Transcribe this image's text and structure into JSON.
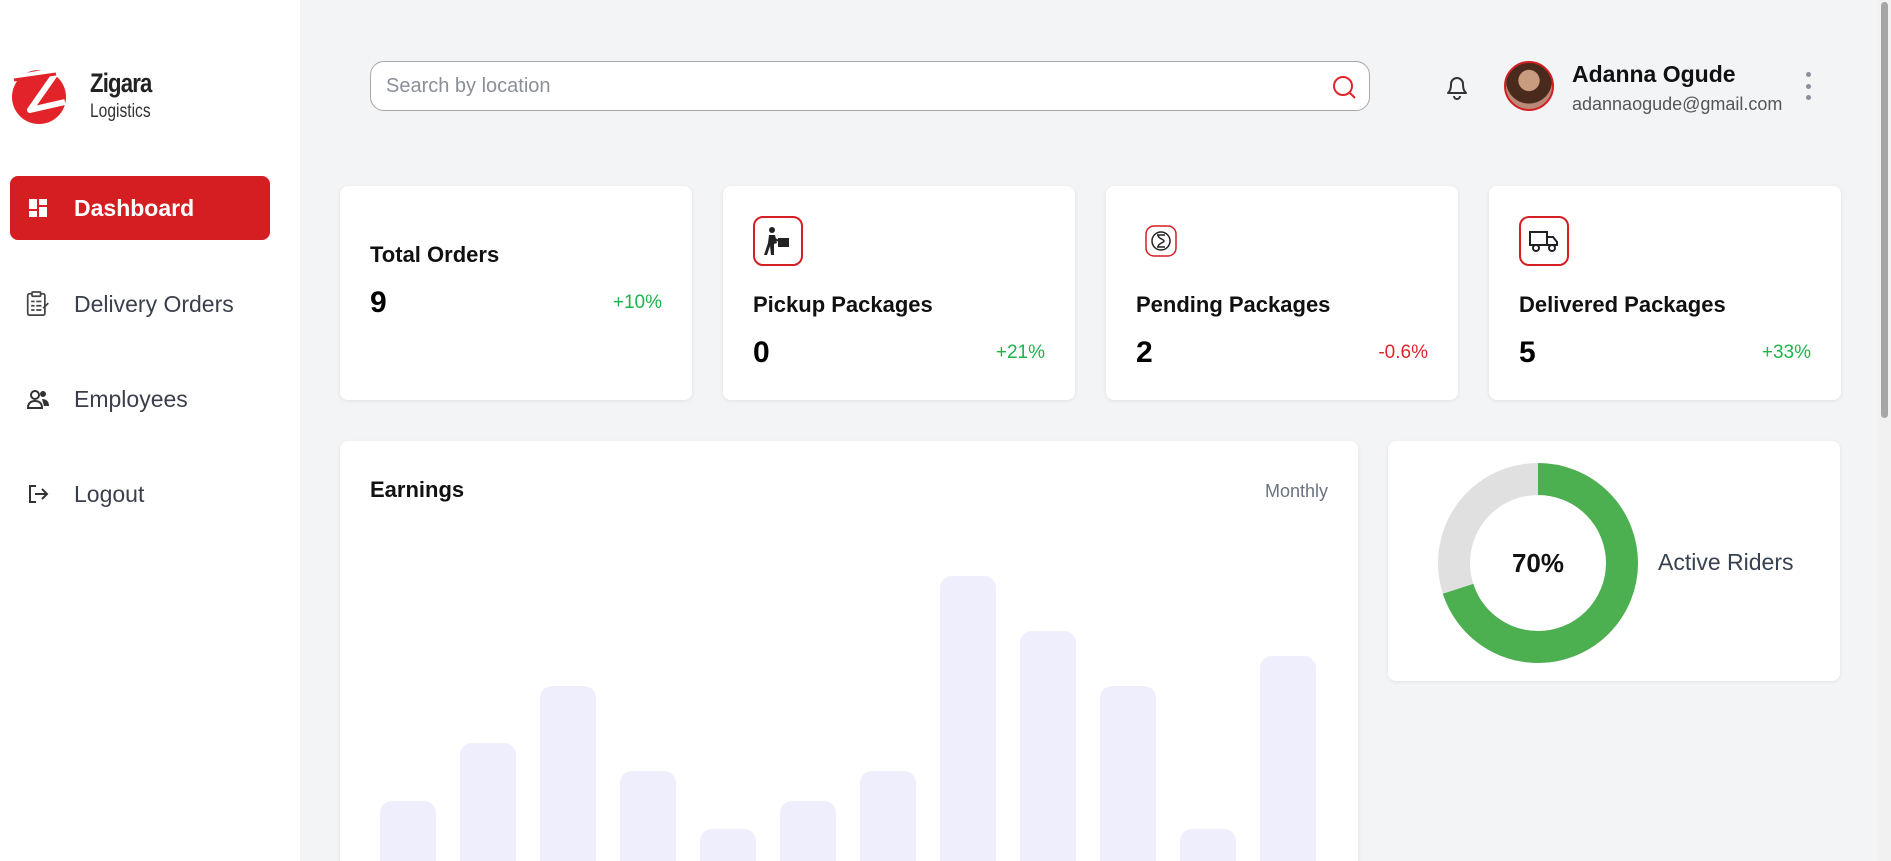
{
  "brand": {
    "name": "Zigara",
    "subtitle": "Logistics",
    "accent": "#d41e22"
  },
  "sidebar": {
    "items": [
      {
        "label": "Dashboard",
        "icon": "dashboard-icon",
        "active": true
      },
      {
        "label": "Delivery Orders",
        "icon": "clipboard-list-icon",
        "active": false
      },
      {
        "label": "Employees",
        "icon": "users-icon",
        "active": false
      },
      {
        "label": "Logout",
        "icon": "logout-icon",
        "active": false
      }
    ]
  },
  "header": {
    "search": {
      "placeholder": "Search by location",
      "value": ""
    },
    "user": {
      "name": "Adanna Ogude",
      "email": "adannaogude@gmail.com"
    }
  },
  "stats": [
    {
      "title": "Total Orders",
      "value": "9",
      "change": "+10%",
      "trend": "up",
      "icon": ""
    },
    {
      "title": "Pickup Packages",
      "value": "0",
      "change": "+21%",
      "trend": "up",
      "icon": "delivery-person-icon"
    },
    {
      "title": "Pending Packages",
      "value": "2",
      "change": "-0.6%",
      "trend": "down",
      "icon": "hourglass-icon"
    },
    {
      "title": "Delivered Packages",
      "value": "5",
      "change": "+33%",
      "trend": "up",
      "icon": "truck-icon"
    }
  ],
  "earnings": {
    "title": "Earnings",
    "period": "Monthly"
  },
  "riders": {
    "label": "Active Riders",
    "percent_label": "70%",
    "percent": 70,
    "active_color": "#4caf50",
    "inactive_color": "#e0e0e0"
  },
  "chart_data": {
    "type": "bar",
    "title": "Earnings",
    "categories": [
      "",
      "",
      "",
      "",
      "",
      "",
      "",
      "",
      "",
      "",
      "",
      "",
      ""
    ],
    "values": [
      60,
      118,
      175,
      90,
      32,
      60,
      90,
      285,
      230,
      175,
      32,
      205
    ],
    "bar_color": "#efeefc",
    "note_hidden_axes": true
  }
}
